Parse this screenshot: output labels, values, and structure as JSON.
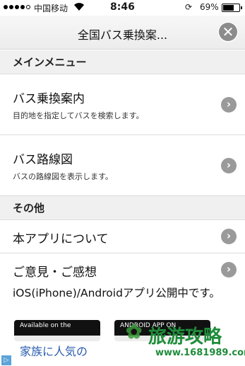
{
  "status_bar": {
    "carrier": "中国移动",
    "time": "8:46",
    "battery": "69%",
    "battery_level": 0.69,
    "wifi_icon": "wifi-icon",
    "lock_icon": "rotation-lock-icon"
  },
  "navbar": {
    "title": "全国バス乗換案...",
    "close_icon": "close-icon"
  },
  "sections": {
    "main_menu": "メインメニュー",
    "other": "その他"
  },
  "menu_items": [
    {
      "title": "バス乗換案内",
      "subtitle": "目的地を指定してバスを検索します。"
    },
    {
      "title": "バス路線図",
      "subtitle": "バスの路線図を表示します。"
    }
  ],
  "other_items": [
    {
      "title": "本アプリについて"
    },
    {
      "title": "ご意見・ご感想"
    }
  ],
  "promo": {
    "text": "iOS(iPhone)/Androidアプリ公開中です。",
    "ios_badge": "Available on the",
    "android_badge": "ANDROID APP ON"
  },
  "ad": {
    "text": "家族に人気の",
    "ad_icon": "ad-choices-icon"
  },
  "watermark": {
    "title": "旅游攻略",
    "url": "www.1681989.com"
  },
  "colors": {
    "chevron": "#9a9a9a",
    "section_bg": "#f0f0f0",
    "ad_text": "#2a5db0",
    "watermark": "#1e8c3a"
  }
}
